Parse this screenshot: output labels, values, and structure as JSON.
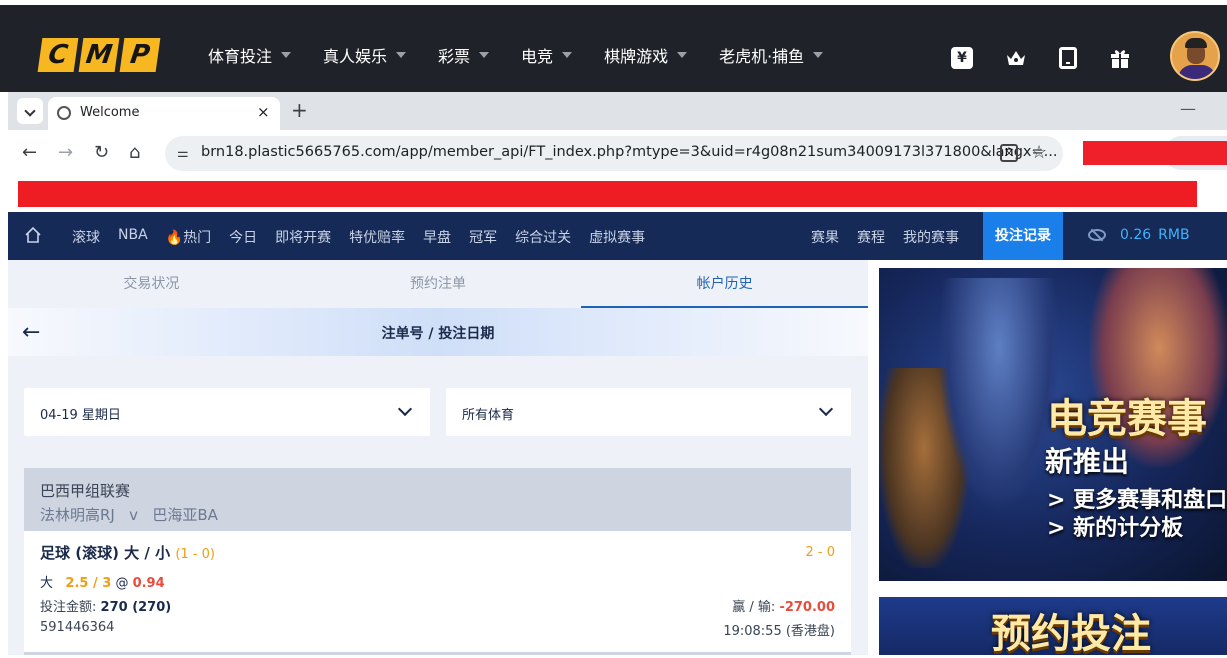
{
  "site": {
    "logo_letters": [
      "C",
      "M",
      "P"
    ],
    "nav": [
      "体育投注",
      "真人娱乐",
      "彩票",
      "电竞",
      "棋牌游戏",
      "老虎机·捕鱼"
    ],
    "icons": [
      "yen-icon",
      "crown-icon",
      "phone-icon",
      "gift-icon"
    ],
    "yen_symbol": "¥"
  },
  "browser": {
    "tab_title": "Welcome",
    "tab_close": "×",
    "new_tab": "+",
    "minimize": "—",
    "url": "brn18.plastic5665765.com/app/member_api/FT_index.php?mtype=3&uid=r4g08n21sum34009173l371800&langx=...",
    "translate_glyph": "文",
    "star_glyph": "☆",
    "back_glyph": "←",
    "forward_glyph": "→",
    "reload_glyph": "↻",
    "home_glyph": "⌂",
    "tune_glyph": "⚌"
  },
  "sports_nav": {
    "left": [
      "滚球",
      "NBA",
      "🔥热门",
      "今日",
      "即将开赛",
      "特优赔率",
      "早盘",
      "冠军",
      "综合过关",
      "虚拟赛事"
    ],
    "right": [
      "赛果",
      "赛程",
      "我的赛事"
    ],
    "active": "投注记录",
    "balance": "0.26",
    "currency": "RMB"
  },
  "subtabs": [
    "交易状况",
    "预约注单",
    "帐户历史"
  ],
  "header_title": "注单号 / 投注日期",
  "filters": {
    "date": "04-19 星期日",
    "sport": "所有体育"
  },
  "bet": {
    "league": "巴西甲组联赛",
    "home": "法林明高RJ",
    "vs": "v",
    "away": "巴海亚BA",
    "market": "足球 (滚球) 大 / 小",
    "score_at_bet": "(1 - 0)",
    "final_score": "2 - 0",
    "pick_label": "大",
    "handicap": "2.5 / 3",
    "at": "@",
    "odds": "0.94",
    "stake_label": "投注金额:",
    "stake": "270 (270)",
    "winloss_label": "赢 / 输:",
    "winloss": "-270.00",
    "ticket_id": "591446364",
    "time": "19:08:55 (香港盘)"
  },
  "banners": {
    "esports_title": "电竞赛事",
    "esports_sub": "新推出",
    "esports_line1": "> 更多赛事和盘口",
    "esports_line2": "> 新的计分板",
    "reserve_title": "预约投注"
  },
  "colors": {
    "site_bar": "#1f2329",
    "logo_yellow": "#f6b721",
    "sports_nav": "#152a56",
    "active_tab": "#1a7fe8",
    "balance": "#3fb3ff",
    "orange": "#f39c12",
    "red": "#e74c3c",
    "redaction": "#ee1d23"
  }
}
